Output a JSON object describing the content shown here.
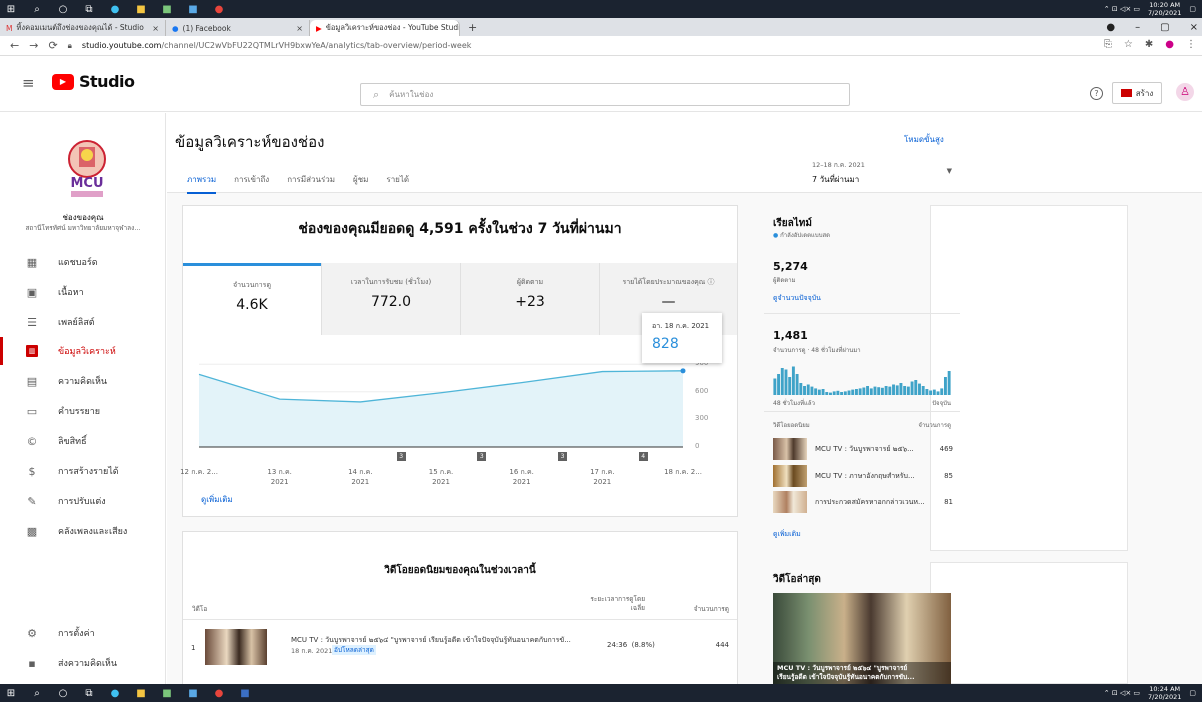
{
  "os": {
    "clock_top_time": "10:20 AM",
    "clock_top_date": "7/20/2021",
    "clock_bottom_time": "10:24 AM",
    "clock_bottom_date": "7/20/2021"
  },
  "browser": {
    "tabs": [
      {
        "label": "ทิ้งคอมเมนต์ถึงช่องของคุณได้ - Studio"
      },
      {
        "label": "(1) Facebook"
      },
      {
        "label": "ข้อมูลวิเคราะห์ของช่อง - YouTube Studio"
      }
    ],
    "new_tab": "+",
    "url_host": "studio.youtube.com",
    "url_path": "/channel/UC2wVbFU22QTMLrVH9bxwYeA/analytics/tab-overview/period-week"
  },
  "header": {
    "logo_text": "Studio",
    "search_placeholder": "ค้นหาในช่อง",
    "create_label": "สร้าง"
  },
  "sidebar": {
    "channel_name": "ช่องของคุณ",
    "channel_sub": "สถานีโทรทัศน์ มหาวิทยาลัยมหาจุฬาลง...",
    "items": [
      {
        "label": "แดชบอร์ด",
        "icon": "dashboard-icon"
      },
      {
        "label": "เนื้อหา",
        "icon": "content-icon"
      },
      {
        "label": "เพลย์ลิสต์",
        "icon": "playlist-icon"
      },
      {
        "label": "ข้อมูลวิเคราะห์",
        "icon": "analytics-icon"
      },
      {
        "label": "ความคิดเห็น",
        "icon": "comments-icon"
      },
      {
        "label": "คำบรรยาย",
        "icon": "subtitles-icon"
      },
      {
        "label": "ลิขสิทธิ์",
        "icon": "copyright-icon"
      },
      {
        "label": "การสร้างรายได้",
        "icon": "monetization-icon"
      },
      {
        "label": "การปรับแต่ง",
        "icon": "customization-icon"
      },
      {
        "label": "คลังเพลงและเสียง",
        "icon": "audio-library-icon"
      }
    ],
    "settings": "การตั้งค่า",
    "feedback": "ส่งความคิดเห็น"
  },
  "page": {
    "title": "ข้อมูลวิเคราะห์ของช่อง",
    "advanced_mode": "โหมดขั้นสูง",
    "tabs": [
      "ภาพรวม",
      "การเข้าถึง",
      "การมีส่วนร่วม",
      "ผู้ชม",
      "รายได้"
    ],
    "date_range": "12–18 ก.ค. 2021",
    "date_preset": "7 วันที่ผ่านมา",
    "headline": "ช่องของคุณมียอดดู 4,591 ครั้งในช่วง 7 วันที่ผ่านมา"
  },
  "metrics": [
    {
      "label": "จำนวนการดู",
      "value": "4.6K"
    },
    {
      "label": "เวลาในการรับชม (ชั่วโมง)",
      "value": "772.0"
    },
    {
      "label": "ผู้ติดตาม",
      "value": "+23"
    },
    {
      "label": "รายได้โดยประมาณของคุณ",
      "value": "—"
    }
  ],
  "tooltip": {
    "date": "อา. 18 ก.ค. 2021",
    "value": "828"
  },
  "chart_data": {
    "type": "area",
    "x": [
      "12 ก.ค. 2...",
      "13 ก.ค. 2021",
      "14 ก.ค. 2021",
      "15 ก.ค. 2021",
      "16 ก.ค. 2021",
      "17 ก.ค. 2021",
      "18 ก.ค. 2..."
    ],
    "values": [
      790,
      520,
      490,
      590,
      700,
      820,
      828
    ],
    "yticks": [
      "900",
      "600",
      "300",
      "0"
    ],
    "ylim": [
      0,
      1000
    ],
    "markers": [
      "3",
      "3",
      "3",
      "4"
    ],
    "color": "#4fb5d8"
  },
  "see_more": "ดูเพิ่มเติม",
  "top_videos": {
    "title": "วิดีโอยอดนิยมของคุณในช่วงเวลานี้",
    "col_video": "วิดีโอ",
    "col_avg": "ระยะเวลาการดูโดยเฉลี่ย",
    "col_views": "จำนวนการดู",
    "rows": [
      {
        "rank": "1",
        "title": "MCU TV : วันบูรพาจารย์ ๒๕๖๔ \"บูรพาจารย์ เรียนรู้อดีต เข้าใจปัจจุบันรู้ทันอนาคตกับการขั...",
        "date": "18 ก.ค. 2021",
        "badge": "อัปโหลดล่าสุด",
        "avg": "24:36  (8.8%)",
        "views": "444"
      }
    ]
  },
  "realtime": {
    "title": "เรียลไทม์",
    "live": "กำลังอัปเดตแบบสด",
    "subs": "5,274",
    "subs_label": "ผู้ติดตาม",
    "subs_link": "ดูจำนวนปัจจุบัน",
    "views": "1,481",
    "views_label": "จำนวนการดู · 48 ชั่วโมงที่ผ่านมา",
    "bars": [
      55,
      70,
      90,
      85,
      60,
      95,
      70,
      40,
      30,
      35,
      28,
      22,
      18,
      20,
      10,
      8,
      12,
      14,
      10,
      12,
      15,
      18,
      20,
      22,
      25,
      30,
      22,
      28,
      26,
      24,
      30,
      28,
      35,
      32,
      40,
      30,
      28,
      45,
      50,
      38,
      30,
      20,
      15,
      18,
      12,
      22,
      60,
      80
    ],
    "from_label": "48 ชั่วโมงที่แล้ว",
    "to_label": "ปัจจุบัน",
    "top_label": "วิดีโอยอดนิยม",
    "views_col": "จำนวนการดู",
    "videos": [
      {
        "title": "MCU TV : วันบูรพาจารย์ ๒๕๖...",
        "views": "469"
      },
      {
        "title": "MCU TV : ภาษาอังกฤษสำหรับ...",
        "views": "85"
      },
      {
        "title": "การประกวดสมัครหาอกกล่าวเวนห...",
        "views": "81"
      }
    ],
    "see_more": "ดูเพิ่มเติม"
  },
  "latest": {
    "title": "วิดีโอล่าสุด",
    "caption1": "MCU TV : วันบูรพาจารย์ ๒๕๖๔ \"บูรพาจารย์",
    "caption2": "เรียนรู้อดีต เข้าใจปัจจุบันรู้ทันอนาคตกับการขับ..."
  }
}
